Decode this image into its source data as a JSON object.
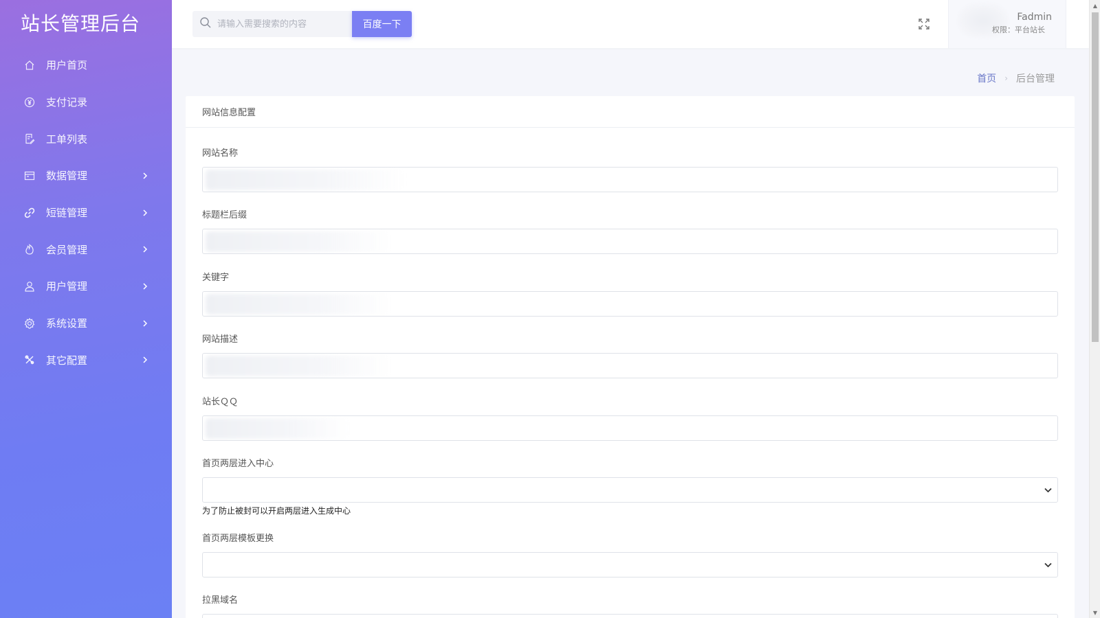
{
  "app": {
    "brand": "站长管理后台"
  },
  "sidebar": {
    "items": [
      {
        "label": "用户首页",
        "icon": "home-icon",
        "has_children": false
      },
      {
        "label": "支付记录",
        "icon": "yen-icon",
        "has_children": false
      },
      {
        "label": "工单列表",
        "icon": "ticket-icon",
        "has_children": false
      },
      {
        "label": "数据管理",
        "icon": "database-icon",
        "has_children": true
      },
      {
        "label": "短链管理",
        "icon": "link-icon",
        "has_children": true
      },
      {
        "label": "会员管理",
        "icon": "fire-icon",
        "has_children": true
      },
      {
        "label": "用户管理",
        "icon": "user-icon",
        "has_children": true
      },
      {
        "label": "系统设置",
        "icon": "gear-icon",
        "has_children": true
      },
      {
        "label": "其它配置",
        "icon": "tools-icon",
        "has_children": true
      }
    ]
  },
  "header": {
    "search_placeholder": "请输入需要搜索的内容",
    "search_button": "百度一下",
    "user_name": "Fadmin",
    "user_role": "权限：平台站长"
  },
  "breadcrumb": {
    "home": "首页",
    "separator": "›",
    "current": "后台管理"
  },
  "card": {
    "title": "网站信息配置",
    "fields": [
      {
        "label": "网站名称",
        "type": "text"
      },
      {
        "label": "标题栏后缀",
        "type": "text"
      },
      {
        "label": "关键字",
        "type": "text"
      },
      {
        "label": "网站描述",
        "type": "text"
      },
      {
        "label": "站长ＱＱ",
        "type": "text"
      },
      {
        "label": "首页两层进入中心",
        "type": "select",
        "help": "为了防止被封可以开启两层进入生成中心"
      },
      {
        "label": "首页两层模板更换",
        "type": "select"
      },
      {
        "label": "拉黑域名",
        "type": "text"
      }
    ]
  },
  "colors": {
    "sidebar_top": "#9b6fe0",
    "sidebar_bottom": "#6b80f4",
    "accent": "#7b7ff3",
    "breadcrumb_link": "#6a78c8"
  }
}
